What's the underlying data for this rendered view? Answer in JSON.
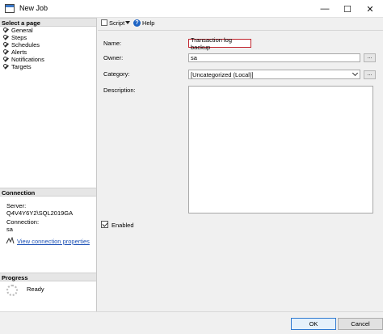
{
  "window": {
    "title": "New Job",
    "minimize": "—",
    "maximize": "☐",
    "close": "✕"
  },
  "left": {
    "select_page": "Select a page",
    "pages": [
      "General",
      "Steps",
      "Schedules",
      "Alerts",
      "Notifications",
      "Targets"
    ],
    "connection_head": "Connection",
    "server_label": "Server:",
    "server_value": "Q4V4Y6Y2\\SQL2019GA",
    "connection_label": "Connection:",
    "connection_value": "sa",
    "view_connection": "View connection properties",
    "progress_head": "Progress",
    "progress_status": "Ready"
  },
  "toolbar": {
    "script_label": "Script",
    "help_label": "Help",
    "help_glyph": "?"
  },
  "form": {
    "name_label": "Name:",
    "name_value": "Transaction log backup",
    "owner_label": "Owner:",
    "owner_value": "sa",
    "category_label": "Category:",
    "category_value": "[Uncategorized (Local)]",
    "description_label": "Description:",
    "ellipsis": "...",
    "enabled_label": "Enabled"
  },
  "buttons": {
    "ok": "OK",
    "cancel": "Cancel"
  },
  "colors": {
    "accent_blue": "#2f7ad1",
    "name_highlight": "#c0232c",
    "link": "#1a4fb5"
  }
}
